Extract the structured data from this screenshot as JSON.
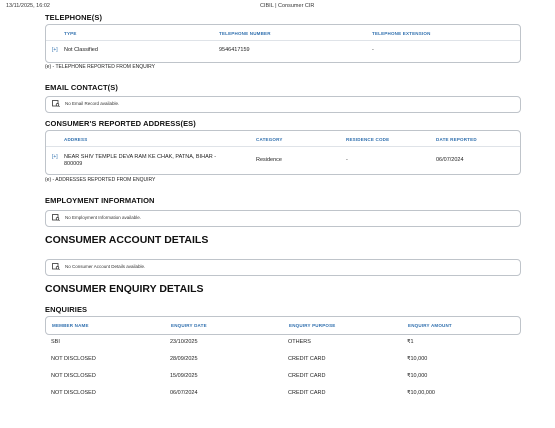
{
  "header": {
    "datetime": "13/11/2025, 16:02",
    "title": "CIBIL | Consumer CIR"
  },
  "telephones": {
    "heading": "TELEPHONE(S)",
    "columns": [
      "TYPE",
      "TELEPHONE NUMBER",
      "TELEPHONE EXTENSION"
    ],
    "rows": [
      {
        "expand": "[+]",
        "type": "Not Classified",
        "number": "9546417159",
        "extension": "-"
      }
    ],
    "note": "(e) - TELEPHONE REPORTED FROM ENQUIRY"
  },
  "email": {
    "heading": "EMAIL CONTACT(S)",
    "empty_text": "No Email Record available."
  },
  "addresses": {
    "heading": "CONSUMER'S REPORTED ADDRESS(ES)",
    "columns": [
      "ADDRESS",
      "CATEGORY",
      "RESIDENCE CODE",
      "DATE REPORTED"
    ],
    "rows": [
      {
        "expand": "[+]",
        "address_line1": "NEAR SHIV TEMPLE DEVA RAM KE CHAK, PATNA, BIHAR -",
        "address_line2": "800009",
        "category": "Residence",
        "residence_code": "-",
        "date_reported": "06/07/2024"
      }
    ],
    "note": "(e) - ADDRESSES REPORTED FROM ENQUIRY"
  },
  "employment": {
    "heading": "EMPLOYMENT INFORMATION",
    "empty_text": "No Employment Information available."
  },
  "accounts": {
    "heading": "CONSUMER ACCOUNT DETAILS",
    "empty_text": "No Consumer Account Details available."
  },
  "enquiry_details": {
    "heading": "CONSUMER ENQUIRY DETAILS"
  },
  "enquiries": {
    "heading": "ENQUIRIES",
    "columns": [
      "MEMBER NAME",
      "ENQUIRY DATE",
      "ENQUIRY PURPOSE",
      "ENQUIRY AMOUNT"
    ],
    "rows": [
      {
        "member": "SBI",
        "date": "23/10/2025",
        "purpose": "OTHERS",
        "amount": "₹1"
      },
      {
        "member": "NOT DISCLOSED",
        "date": "28/09/2025",
        "purpose": "CREDIT CARD",
        "amount": "₹10,000"
      },
      {
        "member": "NOT DISCLOSED",
        "date": "15/09/2025",
        "purpose": "CREDIT CARD",
        "amount": "₹10,000"
      },
      {
        "member": "NOT DISCLOSED",
        "date": "06/07/2024",
        "purpose": "CREDIT CARD",
        "amount": "₹10,00,000"
      }
    ]
  },
  "icons": {
    "empty_record": "document-search-icon"
  },
  "colors": {
    "header_blue": "#2f6fae",
    "border": "#bfc4ca"
  }
}
